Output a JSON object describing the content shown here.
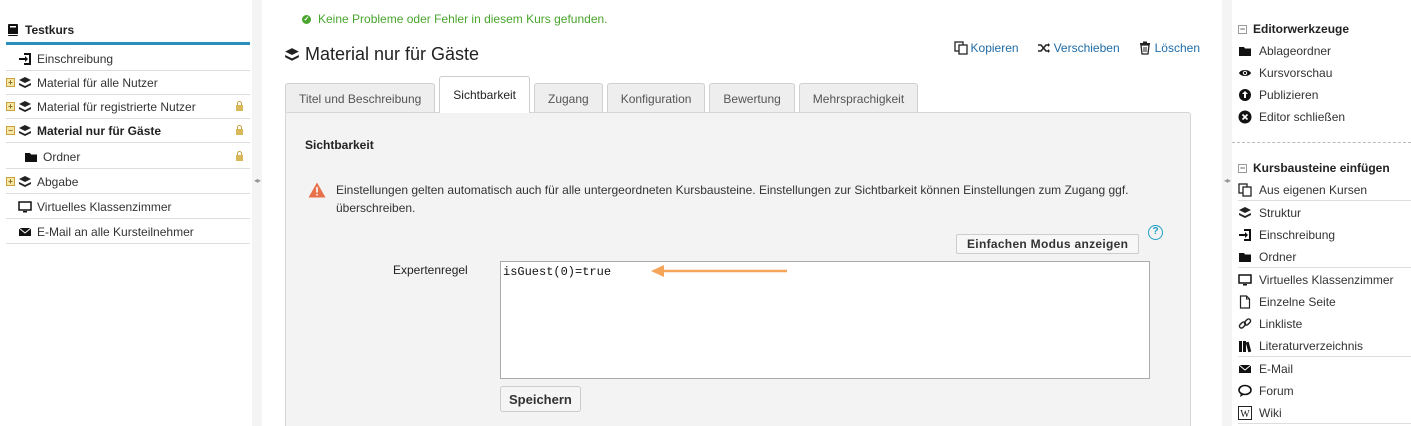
{
  "left_tree": {
    "root_label": "Testkurs",
    "items": [
      {
        "label": "Einschreibung",
        "icon": "enroll-icon"
      },
      {
        "label": "Material für alle Nutzer",
        "icon": "structure-icon"
      },
      {
        "label": "Material für registrierte Nutzer",
        "icon": "structure-icon"
      },
      {
        "label": "Material nur für Gäste",
        "icon": "structure-icon"
      },
      {
        "label": "Ordner",
        "icon": "folder-icon"
      },
      {
        "label": "Abgabe",
        "icon": "structure-icon"
      },
      {
        "label": "Virtuelles Klassenzimmer",
        "icon": "monitor-icon"
      },
      {
        "label": "E-Mail an alle Kursteilnehmer",
        "icon": "mail-icon"
      }
    ]
  },
  "main": {
    "success_message": "Keine Probleme oder Fehler in diesem Kurs gefunden.",
    "title": "Material nur für Gäste",
    "actions": {
      "copy": "Kopieren",
      "move": "Verschieben",
      "delete": "Löschen"
    },
    "tabs": [
      "Titel und Beschreibung",
      "Sichtbarkeit",
      "Zugang",
      "Konfiguration",
      "Bewertung",
      "Mehrsprachigkeit"
    ],
    "active_tab": "Sichtbarkeit",
    "panel": {
      "title": "Sichtbarkeit",
      "warning": "Einstellungen gelten automatisch auch für alle untergeordneten Kursbausteine. Einstellungen zur Sichtbarkeit können Einstellungen zum Zugang ggf. überschreiben.",
      "simple_mode_button": "Einfachen Modus anzeigen",
      "help_glyph": "?",
      "rule_label": "Expertenregel",
      "rule_value": "isGuest(0)=true",
      "save_button": "Speichern"
    }
  },
  "right_sidebar": {
    "editor_tools_title": "Editorwerkzeuge",
    "editor_tools": [
      {
        "label": "Ablageordner",
        "icon": "folder-icon"
      },
      {
        "label": "Kursvorschau",
        "icon": "eye-icon"
      },
      {
        "label": "Publizieren",
        "icon": "publish-icon"
      },
      {
        "label": "Editor schließen",
        "icon": "close-circle-icon"
      }
    ],
    "insert_title": "Kursbausteine einfügen",
    "insert_items": [
      {
        "label": "Aus eigenen Kursen",
        "icon": "copy-icon"
      },
      {
        "label": "Struktur",
        "icon": "structure-icon"
      },
      {
        "label": "Einschreibung",
        "icon": "enroll-icon"
      },
      {
        "label": "Ordner",
        "icon": "folder-icon"
      },
      {
        "label": "Virtuelles Klassenzimmer",
        "icon": "monitor-icon"
      },
      {
        "label": "Einzelne Seite",
        "icon": "page-icon"
      },
      {
        "label": "Linkliste",
        "icon": "link-icon"
      },
      {
        "label": "Literaturverzeichnis",
        "icon": "books-icon"
      },
      {
        "label": "E-Mail",
        "icon": "mail-icon"
      },
      {
        "label": "Forum",
        "icon": "forum-icon"
      },
      {
        "label": "Wiki",
        "icon": "wiki-icon"
      }
    ]
  },
  "colors": {
    "accent": "#2a8fbd",
    "success": "#4aa52e",
    "link": "#1f6ca8",
    "arrow": "#f5a55a",
    "warning": "#e8704a"
  }
}
